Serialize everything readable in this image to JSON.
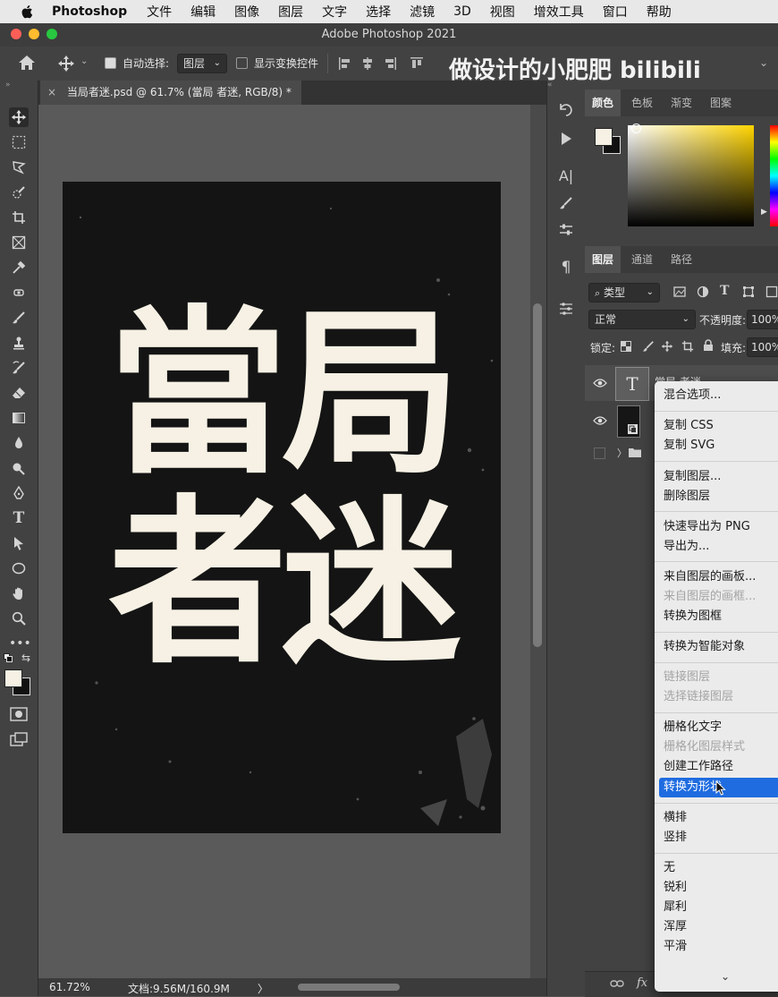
{
  "menubar": {
    "app_name": "Photoshop",
    "items": [
      "文件",
      "编辑",
      "图像",
      "图层",
      "文字",
      "选择",
      "滤镜",
      "3D",
      "视图",
      "增效工具",
      "窗口",
      "帮助"
    ]
  },
  "window": {
    "title": "Adobe Photoshop 2021"
  },
  "options_bar": {
    "auto_select_label": "自动选择:",
    "auto_select_checked": true,
    "auto_select_target": "图层",
    "show_transform_label": "显示变换控件",
    "show_transform_checked": false,
    "watermark": "做设计的小肥肥 bilibili"
  },
  "document": {
    "tab_title": "当局者迷.psd @ 61.7% (當局 者迷, RGB/8) *",
    "canvas_text_line1": "當局",
    "canvas_text_line2": "者迷"
  },
  "status_bar": {
    "zoom": "61.72%",
    "doc_info": "文档:9.56M/160.9M",
    "arrow": "〉"
  },
  "color_panel": {
    "tabs": [
      "颜色",
      "色板",
      "渐变",
      "图案"
    ],
    "active_tab": "颜色"
  },
  "layers_panel": {
    "tabs": [
      "图层",
      "通道",
      "路径"
    ],
    "active_tab": "图层",
    "filter_label": "类型",
    "blend_mode": "正常",
    "opacity_label": "不透明度:",
    "opacity_value": "100%",
    "lock_label": "锁定:",
    "fill_label": "填充:",
    "fill_value": "100%",
    "layers": [
      {
        "name": "當局 者迷",
        "type": "text",
        "visible": true
      },
      {
        "name": "背",
        "type": "smart-object",
        "visible": true
      },
      {
        "name": "",
        "type": "group",
        "visible": false
      }
    ],
    "footer_fx": "fx"
  },
  "context_menu": {
    "groups": [
      [
        {
          "label": "混合选项...",
          "enabled": true
        }
      ],
      [
        {
          "label": "复制 CSS",
          "enabled": true
        },
        {
          "label": "复制 SVG",
          "enabled": true
        }
      ],
      [
        {
          "label": "复制图层...",
          "enabled": true
        },
        {
          "label": "删除图层",
          "enabled": true
        }
      ],
      [
        {
          "label": "快速导出为 PNG",
          "enabled": true
        },
        {
          "label": "导出为...",
          "enabled": true
        }
      ],
      [
        {
          "label": "来自图层的画板...",
          "enabled": true
        },
        {
          "label": "来自图层的画框...",
          "enabled": false
        },
        {
          "label": "转换为图框",
          "enabled": true
        }
      ],
      [
        {
          "label": "转换为智能对象",
          "enabled": true
        }
      ],
      [
        {
          "label": "链接图层",
          "enabled": false
        },
        {
          "label": "选择链接图层",
          "enabled": false
        }
      ],
      [
        {
          "label": "栅格化文字",
          "enabled": true
        },
        {
          "label": "栅格化图层样式",
          "enabled": false
        },
        {
          "label": "创建工作路径",
          "enabled": true
        },
        {
          "label": "转换为形状",
          "enabled": true,
          "selected": true
        }
      ],
      [
        {
          "label": "横排",
          "enabled": true
        },
        {
          "label": "竖排",
          "enabled": true
        }
      ],
      [
        {
          "label": "无",
          "enabled": true
        },
        {
          "label": "锐利",
          "enabled": true
        },
        {
          "label": "犀利",
          "enabled": true
        },
        {
          "label": "浑厚",
          "enabled": true
        },
        {
          "label": "平滑",
          "enabled": true
        }
      ]
    ]
  },
  "colors": {
    "canvas_text": "#f6f1e4",
    "artboard_bg": "#141414",
    "menu_highlight": "#1f6ce0"
  }
}
